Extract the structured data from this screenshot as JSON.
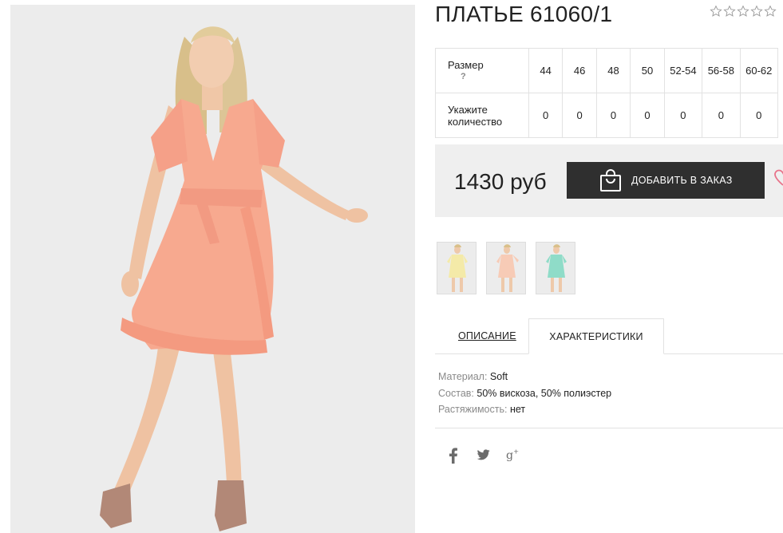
{
  "product": {
    "title": "ПЛАТЬЕ 61060/1",
    "rating": {
      "value": 0,
      "max": 5
    }
  },
  "sizes": {
    "header_label": "Размер",
    "help_label": "?",
    "quantity_label_line1": "Укажите",
    "quantity_label_line2": "количество",
    "items": [
      {
        "size": "44",
        "qty": "0"
      },
      {
        "size": "46",
        "qty": "0"
      },
      {
        "size": "48",
        "qty": "0"
      },
      {
        "size": "50",
        "qty": "0"
      },
      {
        "size": "52-54",
        "qty": "0"
      },
      {
        "size": "56-58",
        "qty": "0"
      },
      {
        "size": "60-62",
        "qty": "0"
      }
    ]
  },
  "buy": {
    "price": "1430 руб",
    "add_button": "ДОБАВИТЬ В ЗАКАЗ",
    "bag_icon": "shopping-bag-icon",
    "heart_icon": "heart-icon"
  },
  "thumbnails": [
    {
      "dress_color": "#f4eaa8"
    },
    {
      "dress_color": "#f7cbb6"
    },
    {
      "dress_color": "#8fdcc8"
    }
  ],
  "tabs": {
    "description": "ОПИСАНИЕ",
    "characteristics": "ХАРАКТЕРИСТИКИ",
    "active": "characteristics"
  },
  "characteristics": [
    {
      "label": "Материал:",
      "value": "Soft"
    },
    {
      "label": "Состав:",
      "value": "50% вискоза, 50% полиэстер"
    },
    {
      "label": "Растяжимость:",
      "value": "нет"
    }
  ],
  "social": [
    "facebook-icon",
    "twitter-icon",
    "google-plus-icon"
  ],
  "colors": {
    "dress": "#f7a98f",
    "button": "#2f2f2f",
    "buy_box_bg": "#efefef",
    "heart": "#e8738a"
  }
}
